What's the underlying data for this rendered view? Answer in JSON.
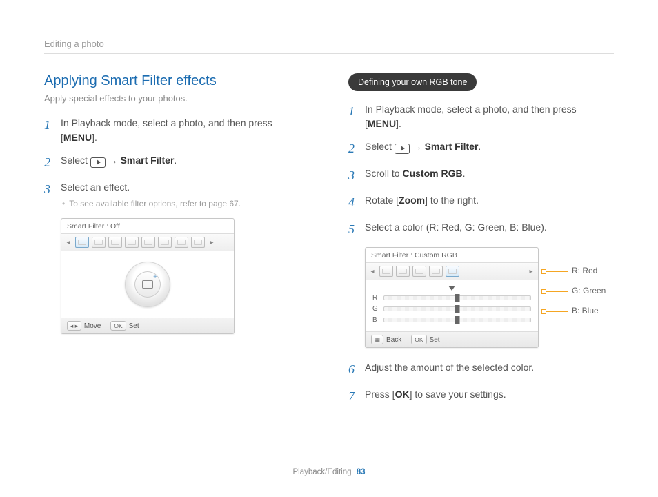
{
  "header": {
    "breadcrumb": "Editing a photo"
  },
  "footer": {
    "section": "Playback/Editing",
    "page": "83"
  },
  "left": {
    "title": "Applying Smart Filter effects",
    "subtitle": "Apply special effects to your photos.",
    "steps": [
      {
        "n": "1",
        "pre": "In Playback mode, select a photo, and then press [",
        "bold": "MENU",
        "post": "]."
      },
      {
        "n": "2",
        "pre": "Select ",
        "icon": "play",
        "mid": " → ",
        "bold": "Smart Filter",
        "post": "."
      },
      {
        "n": "3",
        "pre": "Select an effect.",
        "sub": "To see available filter options, refer to page 67."
      }
    ],
    "cam": {
      "title": "Smart Filter :  Off",
      "foot_move": "Move",
      "foot_set": "Set",
      "btn_arrows": "◂ ▸",
      "btn_ok": "OK"
    }
  },
  "right": {
    "pill": "Defining your own RGB tone",
    "steps": [
      {
        "n": "1",
        "pre": "In Playback mode, select a photo, and then press [",
        "bold": "MENU",
        "post": "]."
      },
      {
        "n": "2",
        "pre": "Select ",
        "icon": "play",
        "mid": " → ",
        "bold": "Smart Filter",
        "post": "."
      },
      {
        "n": "3",
        "pre": "Scroll to ",
        "bold": "Custom RGB",
        "post": "."
      },
      {
        "n": "4",
        "pre": "Rotate [",
        "bold": "Zoom",
        "post": "] to the right."
      },
      {
        "n": "5",
        "pre": "Select a color (R: Red, G: Green, B: Blue)."
      },
      {
        "n": "6",
        "pre": "Adjust the amount of the selected color."
      },
      {
        "n": "7",
        "pre": "Press [",
        "bold": "OK",
        "post": "] to save your settings."
      }
    ],
    "cam": {
      "title": "Smart Filter : Custom RGB",
      "labels": {
        "r": "R",
        "g": "G",
        "b": "B"
      },
      "callouts": {
        "r": "R: Red",
        "g": "G: Green",
        "b": "B: Blue"
      },
      "foot_back": "Back",
      "foot_set": "Set",
      "btn_back_icon": "▦",
      "btn_ok": "OK"
    }
  }
}
